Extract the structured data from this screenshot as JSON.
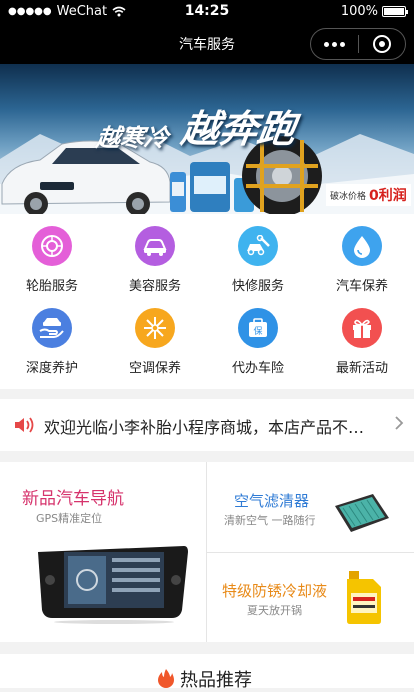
{
  "status_bar": {
    "signal": "●●●●●",
    "carrier": "WeChat",
    "time": "14:25",
    "battery": "100%"
  },
  "nav": {
    "title": "汽车服务"
  },
  "banner": {
    "slogan_small": "越寒冷",
    "slogan_big": "越奔跑",
    "price_label": "破冰价格",
    "price_value": "0利润"
  },
  "services": [
    {
      "label": "轮胎服务",
      "color": "#e45fd8",
      "icon": "tire-icon"
    },
    {
      "label": "美容服务",
      "color": "#b45ee0",
      "icon": "car-beauty-icon"
    },
    {
      "label": "快修服务",
      "color": "#3fb3ef",
      "icon": "repair-icon"
    },
    {
      "label": "汽车保养",
      "color": "#3ea3ee",
      "icon": "oil-drop-icon"
    },
    {
      "label": "深度养护",
      "color": "#4b7fe0",
      "icon": "hand-care-icon"
    },
    {
      "label": "空调保养",
      "color": "#f7a71e",
      "icon": "snowflake-icon"
    },
    {
      "label": "代办车险",
      "color": "#2f92e6",
      "icon": "insurance-icon"
    },
    {
      "label": "最新活动",
      "color": "#f25050",
      "icon": "gift-icon"
    }
  ],
  "notice": {
    "text": "欢迎光临小李补胎小程序商城，本店产品不…"
  },
  "promos": {
    "navigation": {
      "title": "新品汽车导航",
      "subtitle": "GPS精准定位"
    },
    "filter": {
      "title": "空气滤清器",
      "subtitle": "清新空气 一路随行"
    },
    "coolant": {
      "title": "特级防锈冷却液",
      "subtitle": "夏天放开锅"
    }
  },
  "hot": {
    "title": "热品推荐"
  },
  "colors": {
    "accent_red": "#d6221e",
    "nav_bg": "#000000"
  }
}
